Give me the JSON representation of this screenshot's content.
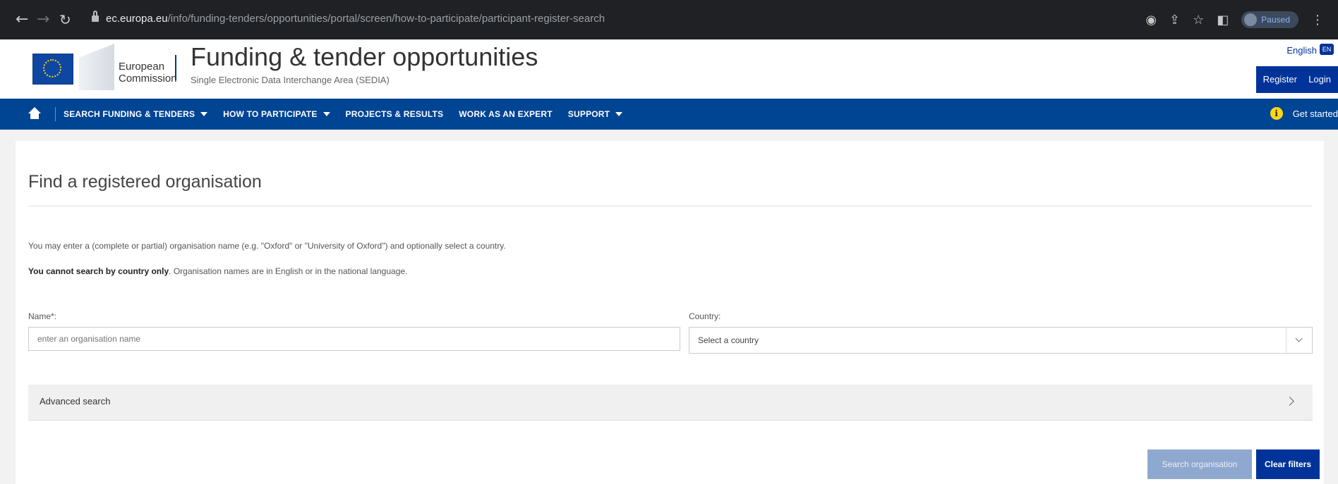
{
  "browser": {
    "url_domain": "ec.europa.eu",
    "url_path": "/info/funding-tenders/opportunities/portal/screen/how-to-participate/participant-register-search",
    "profile_label": "Paused"
  },
  "header": {
    "ec_line1": "European",
    "ec_line2": "Commission",
    "title": "Funding & tender opportunities",
    "subtitle": "Single Electronic Data Interchange Area (SEDIA)",
    "language": "English",
    "language_badge": "EN",
    "register_label": "Register",
    "login_label": "Login"
  },
  "nav": {
    "items": [
      {
        "label": "SEARCH FUNDING & TENDERS"
      },
      {
        "label": "HOW TO PARTICIPATE"
      },
      {
        "label": "PROJECTS & RESULTS"
      },
      {
        "label": "WORK AS AN EXPERT"
      },
      {
        "label": "SUPPORT"
      }
    ],
    "get_started": "Get started"
  },
  "main": {
    "title": "Find a registered organisation",
    "desc1": "You may enter a (complete or partial) organisation name (e.g. \"Oxford\" or \"University of Oxford\") and optionally select a country.",
    "desc2_bold": "You cannot search by country only",
    "desc2_rest": ". Organisation names are in English or in the national language.",
    "name_label": "Name*:",
    "name_placeholder": "enter an organisation name",
    "country_label": "Country:",
    "country_value": "Select a country",
    "advanced_label": "Advanced search",
    "search_button": "Search organisation",
    "clear_button": "Clear filters"
  },
  "colors": {
    "brand_blue": "#003399",
    "nav_blue": "#004494",
    "disabled_blue": "#8fa8cf",
    "info_yellow": "#ffd617"
  }
}
